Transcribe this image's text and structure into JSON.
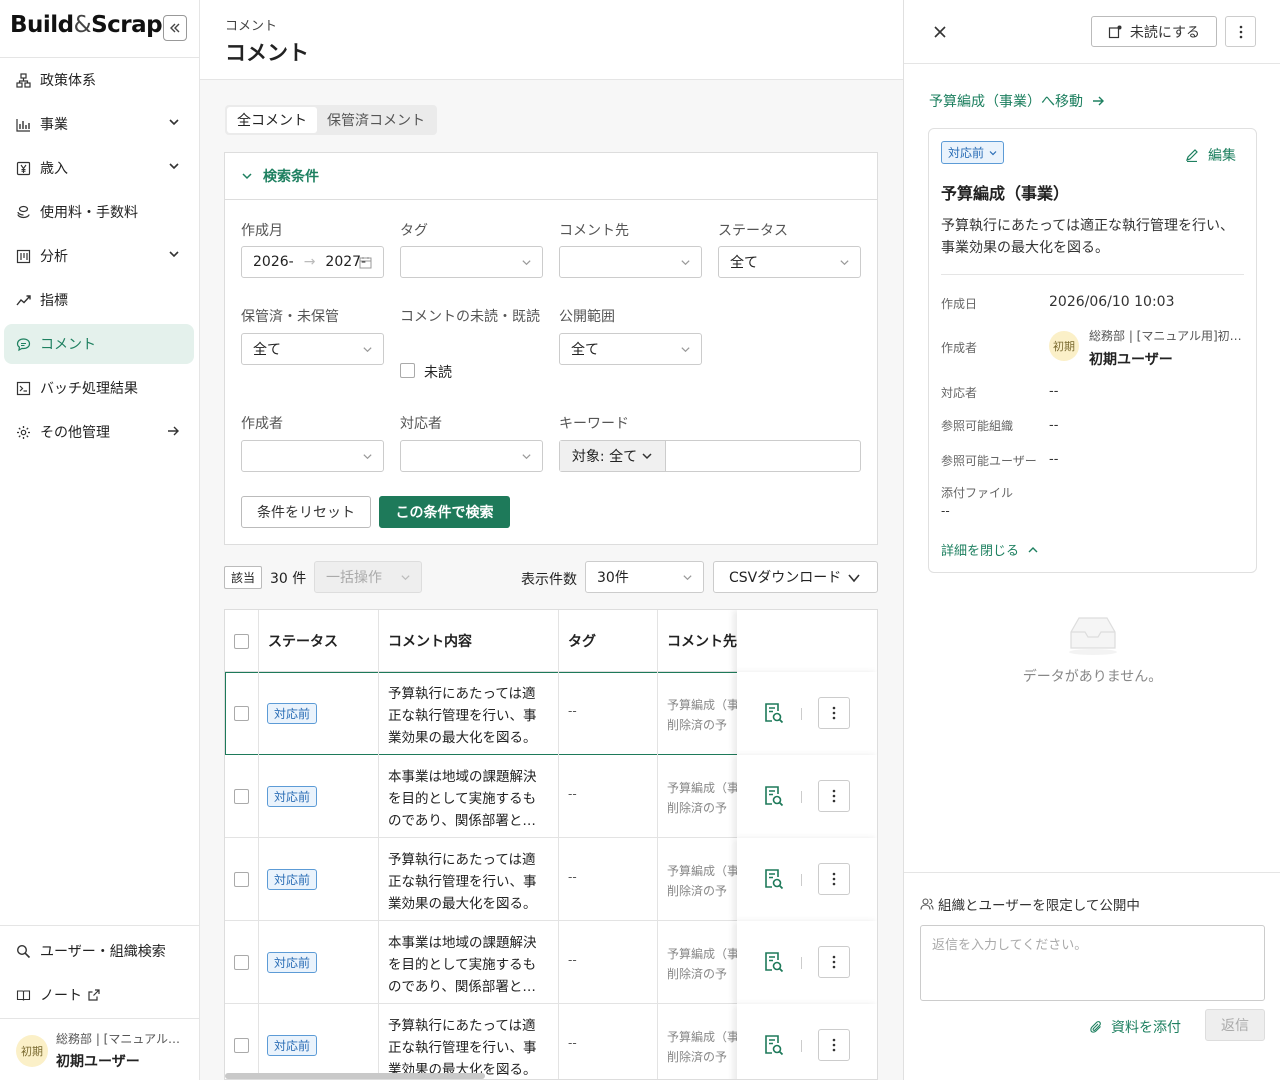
{
  "sidebar": {
    "logo_main": "Build",
    "logo_amp": "&",
    "logo_end": "Scrap",
    "items": [
      {
        "label": "政策体系"
      },
      {
        "label": "事業"
      },
      {
        "label": "歳入"
      },
      {
        "label": "使用料・手数料"
      },
      {
        "label": "分析"
      },
      {
        "label": "指標"
      },
      {
        "label": "コメント"
      },
      {
        "label": "バッチ処理結果"
      },
      {
        "label": "その他管理"
      }
    ],
    "bottom": [
      {
        "label": "ユーザー・組織検索"
      },
      {
        "label": "ノート"
      }
    ],
    "user": {
      "avatar": "初期",
      "org": "総務部 | [マニュアル…",
      "name": "初期ユーザー"
    }
  },
  "header": {
    "breadcrumb": "コメント",
    "title": "コメント"
  },
  "tabs": [
    {
      "label": "全コメント"
    },
    {
      "label": "保管済コメント"
    }
  ],
  "search": {
    "title": "検索条件",
    "created_month": {
      "label": "作成月",
      "from": "2026-",
      "to": "2027-"
    },
    "tag": {
      "label": "タグ"
    },
    "comment_to": {
      "label": "コメント先"
    },
    "status": {
      "label": "ステータス",
      "value": "全て"
    },
    "archived": {
      "label": "保管済・未保管",
      "value": "全て"
    },
    "read": {
      "label": "コメントの未読・既読",
      "checkbox": "未読"
    },
    "scope": {
      "label": "公開範囲",
      "value": "全て"
    },
    "author": {
      "label": "作成者"
    },
    "assignee": {
      "label": "対応者"
    },
    "keyword": {
      "label": "キーワード",
      "target": "対象: 全て"
    },
    "reset_btn": "条件をリセット",
    "search_btn": "この条件で検索"
  },
  "toolbar": {
    "hit_label": "該当",
    "hit_count": "30 件",
    "bulk_btn": "一括操作",
    "page_size_label": "表示件数",
    "page_size": "30件",
    "csv_btn": "CSVダウンロード"
  },
  "table": {
    "headers": [
      "ステータス",
      "コメント内容",
      "タグ",
      "コメント先"
    ],
    "rows": [
      {
        "status": "対応前",
        "content": "予算執行にあたっては適正な執行管理を行い、事業効果の最大化を図る。",
        "tag": "--",
        "target1": "予算編成（事",
        "target2": "削除済の予"
      },
      {
        "status": "対応前",
        "content": "本事業は地域の課題解決を目的として実施するものであり、関係部署と…",
        "tag": "--",
        "target1": "予算編成（事",
        "target2": "削除済の予"
      },
      {
        "status": "対応前",
        "content": "予算執行にあたっては適正な執行管理を行い、事業効果の最大化を図る。",
        "tag": "--",
        "target1": "予算編成（事",
        "target2": "削除済の予"
      },
      {
        "status": "対応前",
        "content": "本事業は地域の課題解決を目的として実施するものであり、関係部署と…",
        "tag": "--",
        "target1": "予算編成（事",
        "target2": "削除済の予"
      },
      {
        "status": "対応前",
        "content": "予算執行にあたっては適正な執行管理を行い、事業効果の最大化を図る。",
        "tag": "--",
        "target1": "予算編成（事",
        "target2": "削除済の予"
      }
    ]
  },
  "panel": {
    "mark_unread": "未読にする",
    "move_link": "予算編成（事業）へ移動",
    "status": "対応前",
    "edit": "編集",
    "title": "予算編成（事業）",
    "body": "予算執行にあたっては適正な執行管理を行い、事業効果の最大化を図る。",
    "created_label": "作成日",
    "created_value": "2026/06/10 10:03",
    "author_label": "作成者",
    "author_org": "総務部 | [マニュアル用]初…",
    "author_name": "初期ユーザー",
    "author_avatar": "初期",
    "assignee_label": "対応者",
    "assignee_value": "--",
    "org_label": "参照可能組織",
    "org_value": "--",
    "user_label": "参照可能ユーザー",
    "user_value": "--",
    "file_label": "添付ファイル",
    "file_value": "--",
    "close_details": "詳細を閉じる",
    "empty": "データがありません。",
    "scope_note": "組織とユーザーを限定して公開中",
    "reply_placeholder": "返信を入力してください。",
    "attach": "資料を添付",
    "reply_btn": "返信"
  },
  "colors": {
    "accent": "#1e7a5a",
    "badge": "#2a6db5"
  }
}
